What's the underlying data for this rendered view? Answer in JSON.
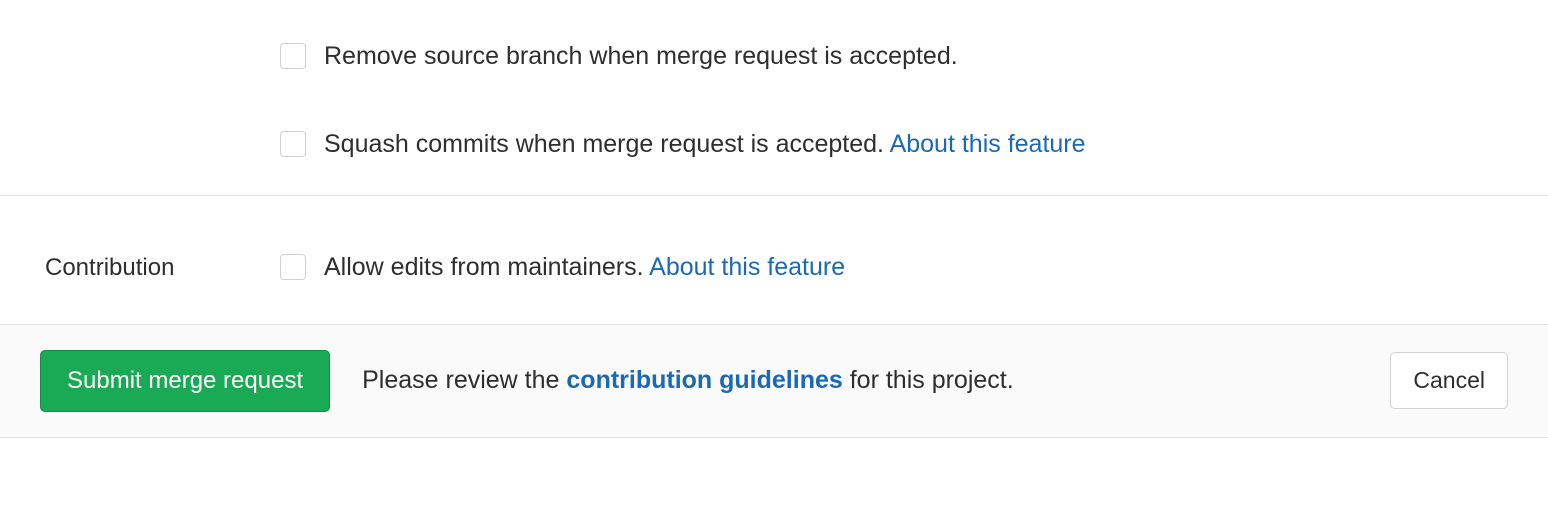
{
  "options": {
    "remove_branch_label": "Remove source branch when merge request is accepted.",
    "squash_commits_label": "Squash commits when merge request is accepted.",
    "squash_link_text": "About this feature"
  },
  "contribution": {
    "section_label": "Contribution",
    "allow_edits_label": "Allow edits from maintainers.",
    "allow_edits_link_text": "About this feature"
  },
  "footer": {
    "submit_label": "Submit merge request",
    "review_prefix": "Please review the",
    "guidelines_link_text": "contribution guidelines",
    "review_suffix": "for this project.",
    "cancel_label": "Cancel"
  }
}
